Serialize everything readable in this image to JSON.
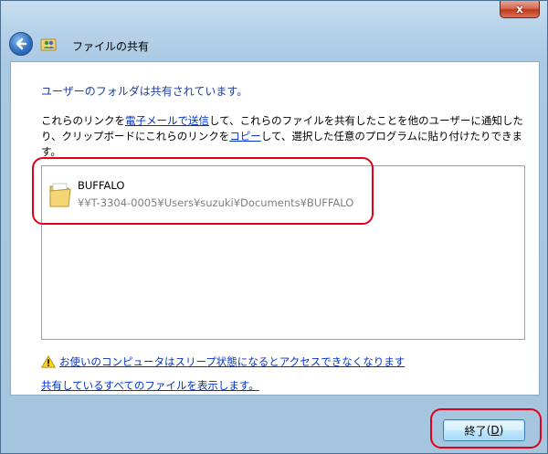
{
  "window": {
    "title": "ファイルの共有",
    "close_label": "x"
  },
  "heading": "ユーザーのフォルダは共有されています。",
  "description": {
    "part1": "これらのリンクを",
    "email_link": "電子メールで送信",
    "part2": "して、これらのファイルを共有したことを他のユーザーに通知したり、クリップボードにこれらのリンクを",
    "copy_link": "コピー",
    "part3": "して、選択した任意のプログラムに貼り付けたりできます。"
  },
  "files": [
    {
      "name": "BUFFALO",
      "path": "¥¥T-3304-0005¥Users¥suzuki¥Documents¥BUFFALO",
      "icon": "folder-icon"
    }
  ],
  "warning": {
    "icon": "warning-icon",
    "text": "お使いのコンピュータはスリープ状態になるとアクセスできなくなります"
  },
  "show_all_link": "共有しているすべてのファイルを表示します。",
  "finish_button": {
    "label": "終了",
    "accesskey_prefix": "(",
    "accesskey": "D",
    "accesskey_suffix": ")"
  },
  "colors": {
    "link": "#0033cc",
    "heading": "#1e3f9a",
    "highlight": "#e0001a"
  }
}
